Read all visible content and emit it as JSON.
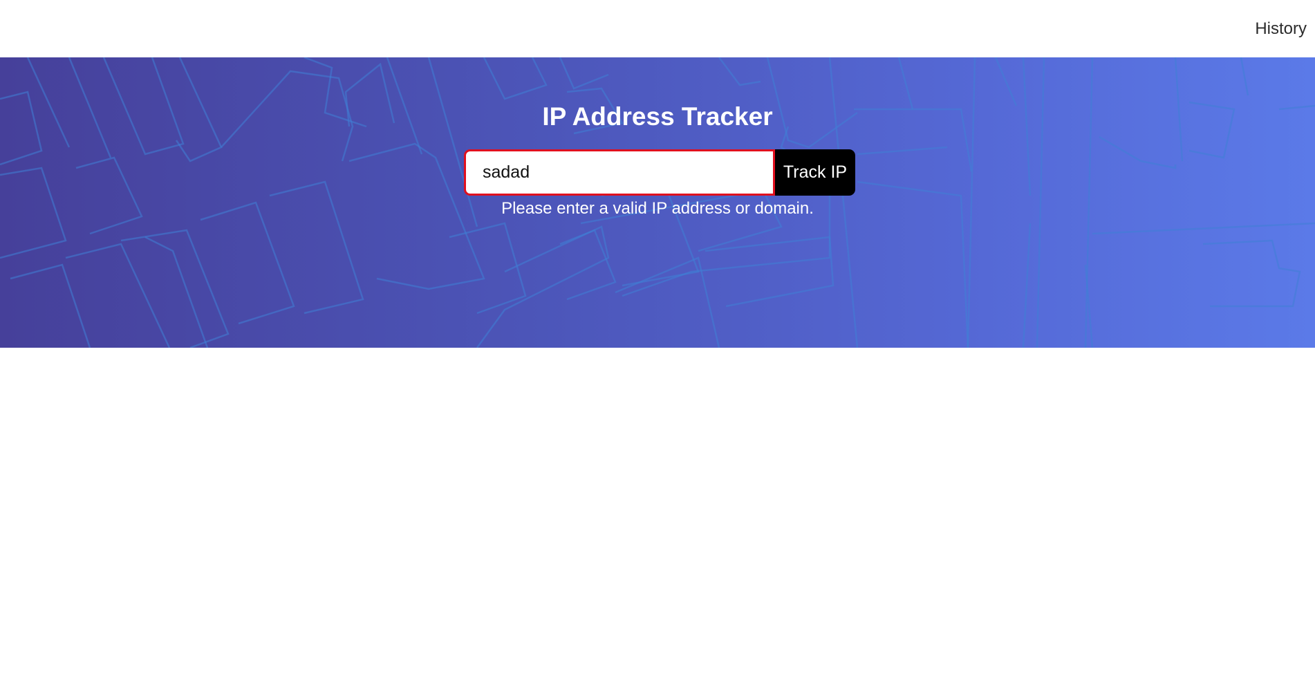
{
  "nav": {
    "history_label": "History"
  },
  "hero": {
    "title": "IP Address Tracker",
    "search": {
      "value": "sadad",
      "placeholder": ""
    },
    "track_button_label": "Track IP",
    "error_message": "Please enter a valid IP address or domain."
  },
  "colors": {
    "gradient_start": "#46409a",
    "gradient_end": "#5b7ae8",
    "input_error_border": "#e0101f",
    "button_bg": "#000000",
    "map_lines": "#3d7fd4"
  }
}
